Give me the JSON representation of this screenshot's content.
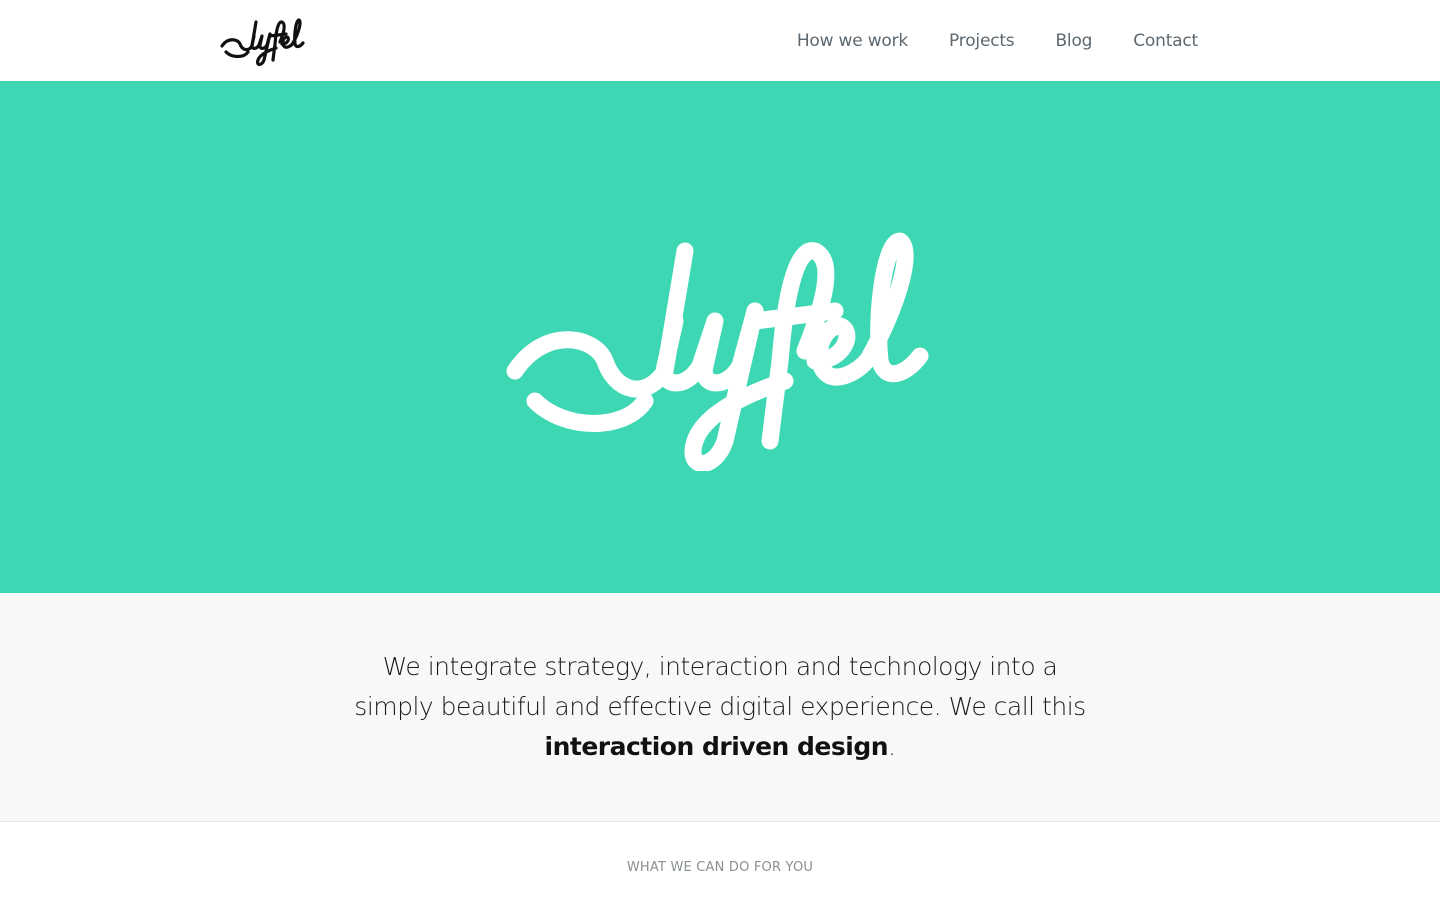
{
  "brand": {
    "name": "Luyfel",
    "accent_color": "#3dd8b3"
  },
  "nav": {
    "items": [
      {
        "label": "How we work"
      },
      {
        "label": "Projects"
      },
      {
        "label": "Blog"
      },
      {
        "label": "Contact"
      }
    ]
  },
  "intro": {
    "line1": "We integrate strategy, interaction and technology into a",
    "line2": "simply beautiful and effective digital experience. We call this",
    "emphasis": "interaction driven design",
    "end": "."
  },
  "services": {
    "heading": "WHAT WE CAN DO FOR YOU"
  }
}
